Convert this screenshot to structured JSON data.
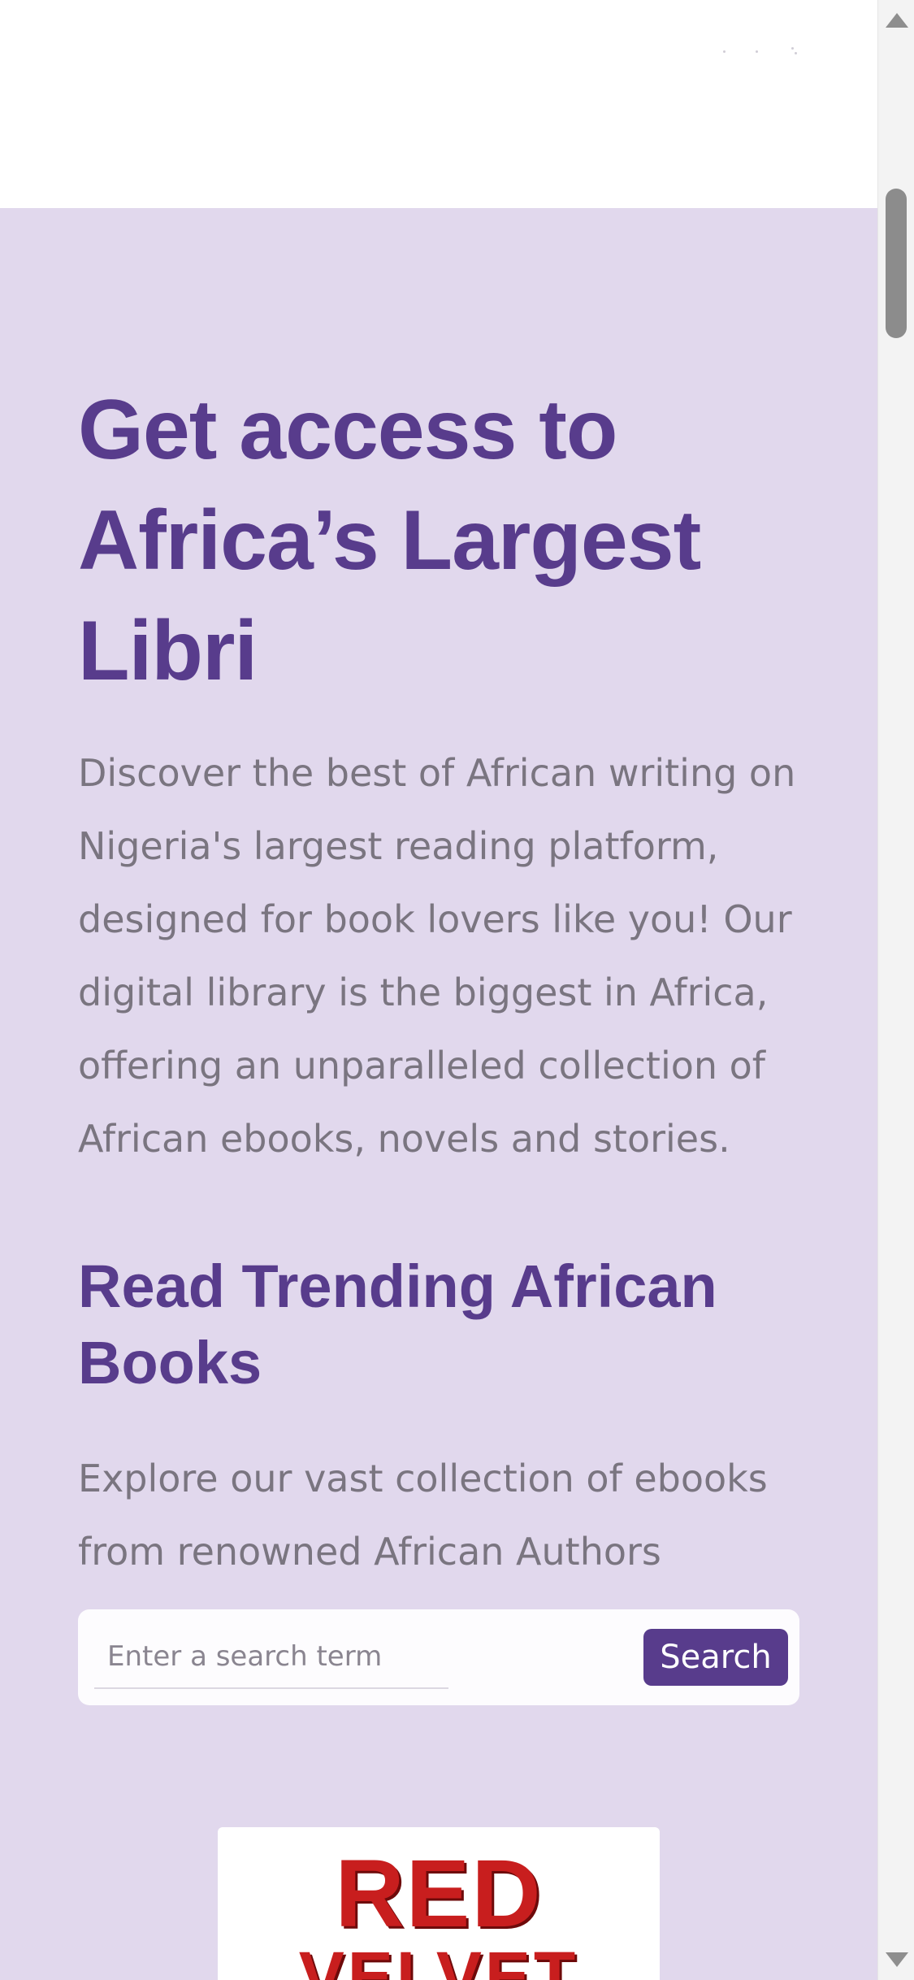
{
  "hero": {
    "title": "Get access to Africa’s Largest Libri",
    "description": "Discover the best of African writing on Nigeria's largest reading platform, designed for book lovers like you! Our digital library is the biggest in Africa, offering an unparalleled collection of African ebooks, novels and stories."
  },
  "trending": {
    "title": "Read Trending African Books",
    "description": "Explore our vast collection of ebooks from renowned African Authors"
  },
  "search": {
    "placeholder": "Enter a search term",
    "button_label": "Search"
  },
  "book": {
    "cover_line1": "RED",
    "cover_line2": "VELVET"
  },
  "colors": {
    "accent": "#583c8c",
    "hero_background": "#e1d8ed",
    "body_text": "#7a7580",
    "cover_red": "#c81e1e"
  },
  "icons": {
    "scroll_up": "triangle-up-icon",
    "scroll_down": "triangle-down-icon"
  }
}
